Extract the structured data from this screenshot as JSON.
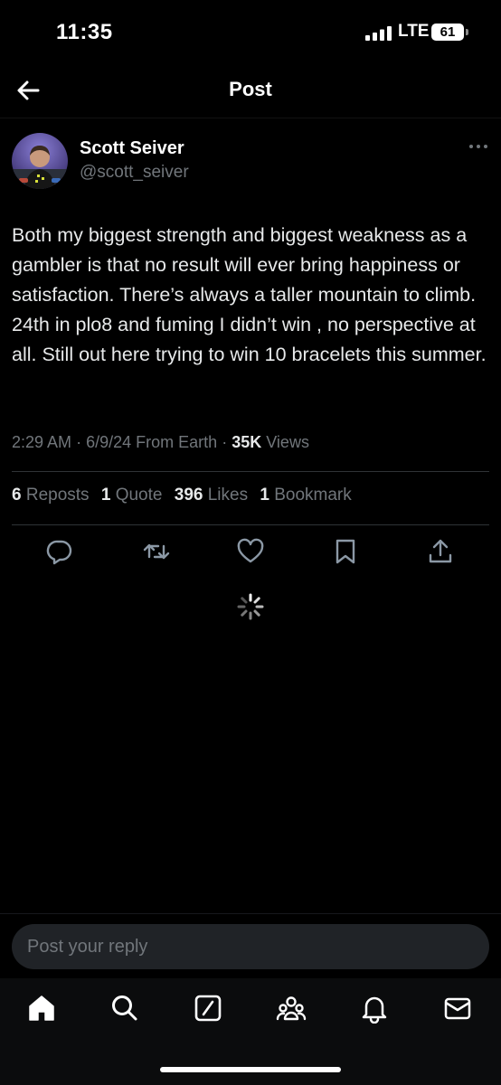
{
  "status_bar": {
    "time": "11:35",
    "network": "LTE",
    "battery": "61"
  },
  "header": {
    "title": "Post"
  },
  "tweet": {
    "author_name": "Scott Seiver",
    "author_handle": "@scott_seiver",
    "text": "Both my biggest strength and biggest weakness as a gambler is that no result will ever bring happiness or satisfaction. There’s always a taller mountain to climb. 24th in plo8 and fuming I didn’t win , no perspective at all. Still out here trying to win 10 bracelets this summer.",
    "time": "2:29 AM",
    "date": "6/9/24",
    "source": "From Earth",
    "views_count": "35K",
    "views_label": "Views"
  },
  "stats": {
    "reposts_count": "6",
    "reposts_label": "Reposts",
    "quotes_count": "1",
    "quotes_label": "Quote",
    "likes_count": "396",
    "likes_label": "Likes",
    "bookmarks_count": "1",
    "bookmarks_label": "Bookmark"
  },
  "actions": [
    "reply-icon",
    "repost-icon",
    "like-icon",
    "bookmark-icon",
    "share-icon"
  ],
  "reply": {
    "placeholder": "Post your reply"
  },
  "nav": [
    "home-icon",
    "search-icon",
    "grok-icon",
    "communities-icon",
    "notifications-icon",
    "messages-icon"
  ],
  "colors": {
    "background": "#000000",
    "text": "#e7e9ea",
    "secondary": "#71767b",
    "divider": "#2f3336"
  }
}
